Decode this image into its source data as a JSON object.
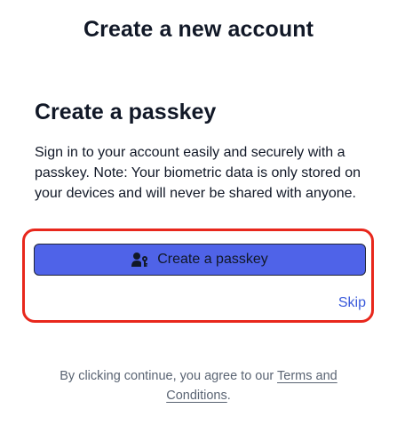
{
  "page": {
    "title": "Create a new account"
  },
  "passkey": {
    "heading": "Create a passkey",
    "description": "Sign in to your account easily and securely with a passkey. Note: Your biometric data is only stored on your devices and will never be shared with anyone.",
    "create_button_label": "Create a passkey",
    "create_button_icon": "user-key-icon",
    "skip_label": "Skip"
  },
  "footer": {
    "prefix": "By clicking continue, you agree to our ",
    "terms_link": "Terms and Conditions",
    "suffix": "."
  },
  "colors": {
    "button_bg": "#4f63e8",
    "link": "#3b5bdb",
    "highlight_border": "#e8271c"
  }
}
